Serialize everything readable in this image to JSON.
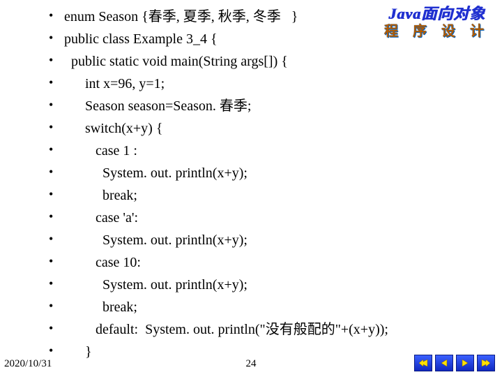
{
  "corner": {
    "line1": "Java面向对象",
    "line2": "程 序 设 计"
  },
  "code": {
    "lines": [
      "enum Season {春季, 夏季, 秋季, 冬季   }",
      "public class Example 3_4 {",
      "  public static void main(String args[]) {",
      "      int x=96, y=1;",
      "      Season season=Season. 春季;",
      "      switch(x+y) {",
      "         case 1 :",
      "           System. out. println(x+y);",
      "           break;",
      "         case 'a':",
      "           System. out. println(x+y);",
      "         case 10:",
      "           System. out. println(x+y);",
      "           break;",
      "         default:  System. out. println(\"没有般配的\"+(x+y));",
      "      }"
    ]
  },
  "footer": {
    "date": "2020/10/31",
    "page": "24"
  },
  "nav": {
    "first": "first",
    "prev": "prev",
    "next": "next",
    "last": "last"
  }
}
